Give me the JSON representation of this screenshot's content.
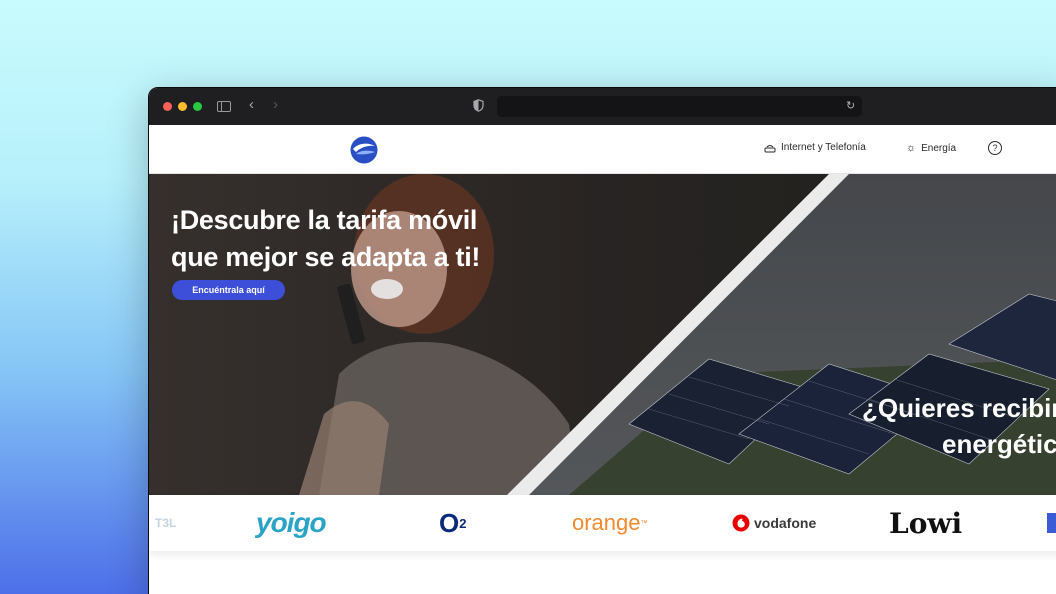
{
  "browser": {
    "address": ""
  },
  "header": {
    "nav": {
      "internet": "Internet y Telefonía",
      "energia": "Energía"
    },
    "help": "?"
  },
  "hero": {
    "title_line1": "¡Descubre la tarifa móvil",
    "title_line2": "que mejor se adapta a ti!",
    "button": "Encuéntrala aquí",
    "second_title_line1": "¿Quieres recibir",
    "second_title_line2": "energétic"
  },
  "brands": {
    "t3l": "T3L",
    "yoigo": "yoigo",
    "o2": "O",
    "o2_sub": "2",
    "orange": "orange",
    "orange_tm": "™",
    "vodafone": "vodafone",
    "lowi": "Lowi"
  },
  "colors": {
    "accent": "#3d4ed8",
    "titlebar": "#1f1f22"
  }
}
